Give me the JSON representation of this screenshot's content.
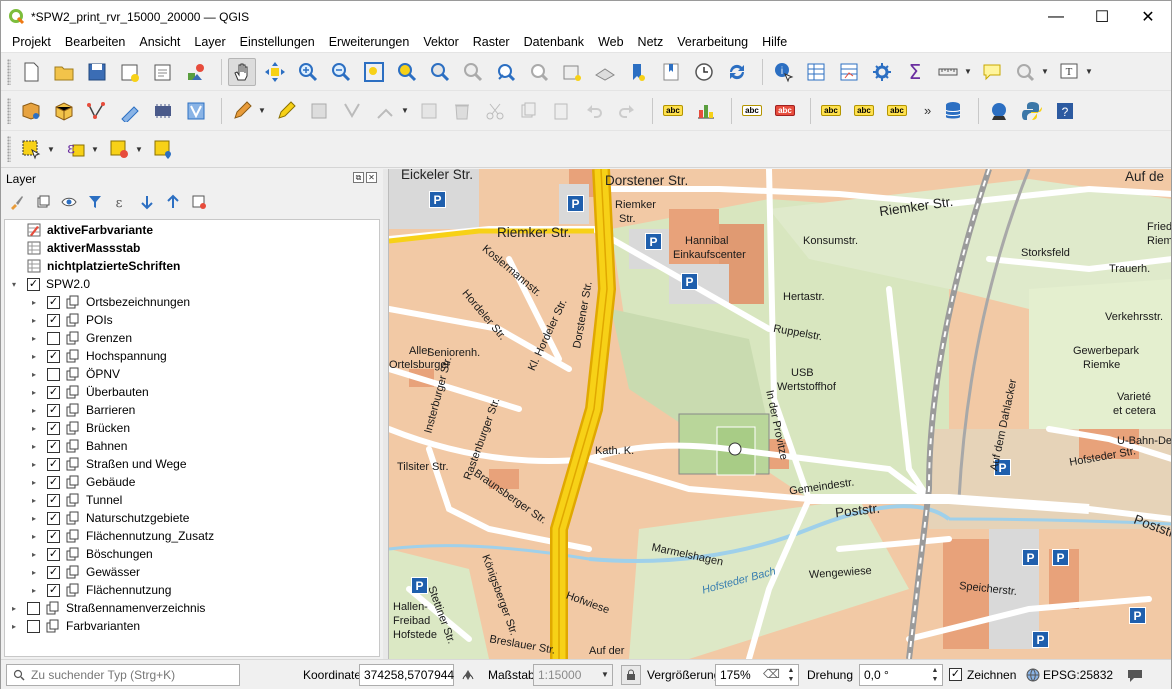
{
  "window": {
    "title": "*SPW2_print_rvr_15000_20000 — QGIS",
    "controls": {
      "minimize": "—",
      "maximize": "☐",
      "close": "✕"
    }
  },
  "menu": [
    {
      "label": "Projekt"
    },
    {
      "label": "Bearbeiten"
    },
    {
      "label": "Ansicht"
    },
    {
      "label": "Layer"
    },
    {
      "label": "Einstellungen"
    },
    {
      "label": "Erweiterungen"
    },
    {
      "label": "Vektor"
    },
    {
      "label": "Raster"
    },
    {
      "label": "Datenbank"
    },
    {
      "label": "Web"
    },
    {
      "label": "Netz"
    },
    {
      "label": "Verarbeitung"
    },
    {
      "label": "Hilfe"
    }
  ],
  "toolbar_labels": {
    "abc": "abc",
    "more": "»"
  },
  "layers_panel": {
    "title": "Layer",
    "items": [
      {
        "label": "aktiveFarbvariante",
        "bold": true,
        "checkbox": false,
        "indent": 0,
        "expander": false,
        "icon": "table-pen-icon"
      },
      {
        "label": "aktiverMassstab",
        "bold": true,
        "checkbox": false,
        "indent": 0,
        "expander": false,
        "icon": "table-icon"
      },
      {
        "label": "nichtplatzierteSchriften",
        "bold": true,
        "checkbox": false,
        "indent": 0,
        "expander": false,
        "icon": "table-icon"
      },
      {
        "label": "SPW2.0",
        "bold": false,
        "checkbox": true,
        "checked": true,
        "indent": 0,
        "expander": "open",
        "icon": "none"
      },
      {
        "label": "Ortsbezeichnungen",
        "checkbox": true,
        "checked": true,
        "indent": 1,
        "expander": "closed",
        "icon": "group-icon"
      },
      {
        "label": "POIs",
        "checkbox": true,
        "checked": true,
        "indent": 1,
        "expander": "closed",
        "icon": "group-icon"
      },
      {
        "label": "Grenzen",
        "checkbox": true,
        "checked": false,
        "indent": 1,
        "expander": "closed",
        "icon": "group-icon"
      },
      {
        "label": "Hochspannung",
        "checkbox": true,
        "checked": true,
        "indent": 1,
        "expander": "closed",
        "icon": "group-icon"
      },
      {
        "label": "ÖPNV",
        "checkbox": true,
        "checked": false,
        "indent": 1,
        "expander": "closed",
        "icon": "group-icon"
      },
      {
        "label": "Überbauten",
        "checkbox": true,
        "checked": true,
        "indent": 1,
        "expander": "closed",
        "icon": "group-icon"
      },
      {
        "label": "Barrieren",
        "checkbox": true,
        "checked": true,
        "indent": 1,
        "expander": "closed",
        "icon": "group-icon"
      },
      {
        "label": "Brücken",
        "checkbox": true,
        "checked": true,
        "indent": 1,
        "expander": "closed",
        "icon": "group-icon"
      },
      {
        "label": "Bahnen",
        "checkbox": true,
        "checked": true,
        "indent": 1,
        "expander": "closed",
        "icon": "group-icon"
      },
      {
        "label": "Straßen und Wege",
        "checkbox": true,
        "checked": true,
        "indent": 1,
        "expander": "closed",
        "icon": "group-icon"
      },
      {
        "label": "Gebäude",
        "checkbox": true,
        "checked": true,
        "indent": 1,
        "expander": "closed",
        "icon": "group-icon"
      },
      {
        "label": "Tunnel",
        "checkbox": true,
        "checked": true,
        "indent": 1,
        "expander": "closed",
        "icon": "group-icon"
      },
      {
        "label": "Naturschutzgebiete",
        "checkbox": true,
        "checked": true,
        "indent": 1,
        "expander": "closed",
        "icon": "group-icon"
      },
      {
        "label": "Flächennutzung_Zusatz",
        "checkbox": true,
        "checked": true,
        "indent": 1,
        "expander": "closed",
        "icon": "group-icon"
      },
      {
        "label": "Böschungen",
        "checkbox": true,
        "checked": true,
        "indent": 1,
        "expander": "closed",
        "icon": "group-icon"
      },
      {
        "label": "Gewässer",
        "checkbox": true,
        "checked": true,
        "indent": 1,
        "expander": "closed",
        "icon": "group-icon"
      },
      {
        "label": "Flächennutzung",
        "checkbox": true,
        "checked": true,
        "indent": 1,
        "expander": "closed",
        "icon": "group-icon"
      },
      {
        "label": "Straßennamenverzeichnis",
        "checkbox": true,
        "checked": false,
        "indent": 0,
        "expander": "closed",
        "icon": "group-icon"
      },
      {
        "label": "Farbvarianten",
        "checkbox": true,
        "checked": false,
        "indent": 0,
        "expander": "closed",
        "icon": "group-icon"
      }
    ]
  },
  "map_labels": {
    "eickeler": "Eickeler Str.",
    "dorstener_top": "Dorstener Str.",
    "auf_de": "Auf de",
    "riemker_right": "Riemker Str.",
    "riemker_left": "Riemker Str.",
    "riemker_small1": "Riemker",
    "riemker_small2": "Str.",
    "hannibal": "Hannibal",
    "einkaufscenter": "Einkaufscenter",
    "konsumstr": "Konsumstr.",
    "storksfeld": "Storksfeld",
    "fried": "Fried",
    "riem": "Riem",
    "trauerh": "Trauerh.",
    "hertastr": "Hertastr.",
    "ruppelstr": "Ruppelstr.",
    "verkehrsstr": "Verkehrsstr.",
    "gewerbepark": "Gewerbepark",
    "riemke": "Riemke",
    "usb": "USB",
    "wertstoffhof": "Wertstoffhof",
    "variete": "Varieté",
    "et_cetera": "et cetera",
    "u_bahn": "U-Bahn-Depo",
    "seniorenh": "Seniorenh.",
    "aller": "Aller",
    "ortelsburger": "Ortelsburger",
    "kosler": "Koslermannstr.",
    "hordeler": "Hordeler Str.",
    "kl_hordeler": "Kl. Hordeler Str.",
    "dorstener_v": "Dorstener Str.",
    "in_der_provitze": "In der Provitze",
    "auf_dem_dahlacker": "Auf dem Dahlacker",
    "hofsteder": "Hofsteder Str.",
    "kath": "Kath. K.",
    "tilsiter": "Tilsiter Str.",
    "rastenburger": "Rastenburger Str.",
    "insterburger": "Insterburger Str.",
    "braunsberger": "Braunsberger Str.",
    "gemeindestr": "Gemeindestr.",
    "poststr": "Poststr.",
    "poststr2": "Poststr.",
    "marmelshagen": "Marmelshagen",
    "wengewiese": "Wengewiese",
    "hofsteder_bach": "Hofsteder Bach",
    "hofwiese": "Hofwiese",
    "speicherstr": "Speicherstr.",
    "hallen": "Hallen-",
    "freibad": "Freibad",
    "hofstede": "Hofstede",
    "stettiner": "Stettiner Str.",
    "koenigsberger": "Königsberger Str.",
    "auf_der": "Auf der",
    "breslauer": "Breslauer Str.",
    "parking": "P"
  },
  "statusbar": {
    "search_placeholder": "Zu suchender Typ (Strg+K)",
    "coordinate_label": "Koordinate",
    "coordinate_value": "374258,5707944",
    "scale_label": "Maßstab",
    "scale_value": "1:15000",
    "magnifier_label": "Vergrößerung",
    "magnifier_value": "175%",
    "rotation_label": "Drehung",
    "rotation_value": "0,0 °",
    "render_label": "Zeichnen",
    "render_checked": "✓",
    "crs": "EPSG:25832"
  },
  "colors": {
    "accent_green": "#7cbd3c",
    "road_yellow": "#f7d117",
    "road_outline": "#e0a800",
    "building_orange": "#e8a27a",
    "built_area": "#f2c9a5",
    "green_area": "#dbe8c4",
    "park_green": "#c9dbb0",
    "parking_blue": "#1f5fad",
    "water_blue": "#9fd0ea"
  }
}
